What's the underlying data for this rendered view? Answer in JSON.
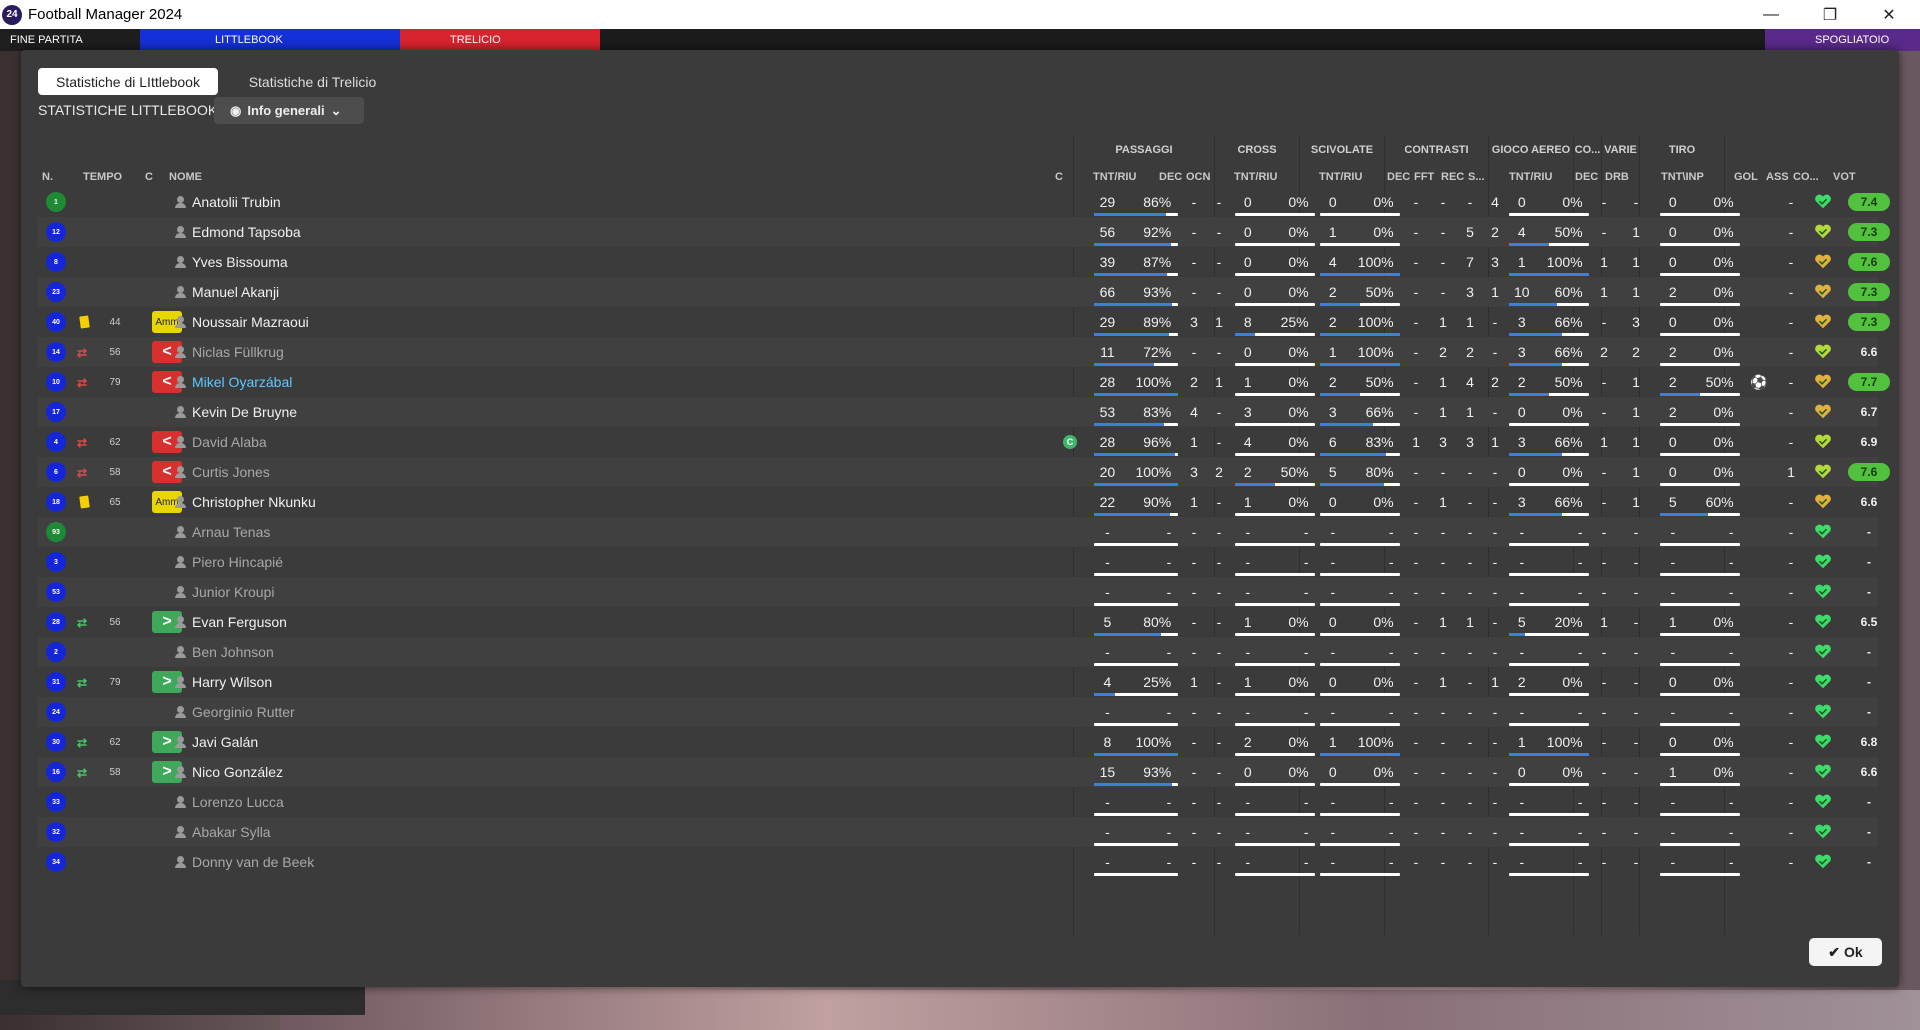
{
  "app": {
    "title": "Football Manager 2024",
    "logo_text": "24"
  },
  "window_controls": {
    "minimize": "—",
    "maximize": "❐",
    "close": "✕"
  },
  "topbar": {
    "match_end": "FINE PARTITA",
    "home": "LITTLEBOOK",
    "away": "TRELICIO",
    "right": "SPOGLIATOIO"
  },
  "tabs": [
    {
      "label": "Statistiche di LIttlebook",
      "active": true
    },
    {
      "label": "Statistiche di Trelicio",
      "active": false
    }
  ],
  "subheader": "STATISTICHE LITTLEBOOK",
  "dropdown": {
    "label": "Info generali"
  },
  "groups": {
    "passaggi": "PASSAGGI",
    "cross": "CROSS",
    "scivolate": "SCIVOLATE",
    "contrasti": "CONTRASTI",
    "gioco_aereo": "GIOCO AEREO",
    "co": "CO...",
    "varie": "VARIE",
    "tiro": "TIRO"
  },
  "columns": {
    "num": "N.",
    "tempo": "TEMPO",
    "c": "C",
    "nome": "NOME",
    "c2": "C",
    "pass_tr": "TNT/RIU",
    "pass_dec": "DEC",
    "pass_ocn": "OCN",
    "cross_tr": "TNT/RIU",
    "scivolate_tr": "TNT/RIU",
    "con_dec": "DEC",
    "con_fft": "FFT",
    "con_rec": "REC",
    "con_s": "S...",
    "aereo_tr": "TNT/RIU",
    "co_dec": "DEC",
    "varie_drb": "DRB",
    "tiro_tr": "TNT\\INP",
    "gol": "GOL",
    "ass": "ASS",
    "co2": "CO...",
    "vot": "VOT"
  },
  "players": [
    {
      "num": "1",
      "gk": true,
      "min": "",
      "badge": "",
      "card": "",
      "name": "Anatolii Trubin",
      "active": true,
      "captain": false,
      "p_t": "29",
      "p_p": "86%",
      "p_f": 0.86,
      "p_dec": "-",
      "p_ocn": "-",
      "c_t": "0",
      "c_p": "0%",
      "c_f": 0,
      "s_t": "0",
      "s_p": "0%",
      "s_f": 0,
      "k_dec": "-",
      "k_fft": "-",
      "k_rec": "-",
      "k_s": "4",
      "a_t": "0",
      "a_p": "0%",
      "a_f": 0,
      "o_dec": "-",
      "drb": "-",
      "t_t": "0",
      "t_p": "0%",
      "t_f": 0,
      "gol": "",
      "ass": "-",
      "heart": "#3ddb6a",
      "vote": "7.4",
      "hi": true
    },
    {
      "num": "12",
      "gk": false,
      "min": "",
      "badge": "",
      "card": "",
      "name": "Edmond Tapsoba",
      "active": true,
      "captain": false,
      "p_t": "56",
      "p_p": "92%",
      "p_f": 0.92,
      "p_dec": "-",
      "p_ocn": "-",
      "c_t": "0",
      "c_p": "0%",
      "c_f": 0,
      "s_t": "1",
      "s_p": "0%",
      "s_f": 0,
      "k_dec": "-",
      "k_fft": "-",
      "k_rec": "5",
      "k_s": "2",
      "a_t": "4",
      "a_p": "50%",
      "a_f": 0.5,
      "o_dec": "-",
      "drb": "1",
      "t_t": "0",
      "t_p": "0%",
      "t_f": 0,
      "gol": "",
      "ass": "-",
      "heart": "#b5d83a",
      "vote": "7.3",
      "hi": true
    },
    {
      "num": "8",
      "gk": false,
      "min": "",
      "badge": "",
      "card": "",
      "name": "Yves Bissouma",
      "active": true,
      "captain": false,
      "p_t": "39",
      "p_p": "87%",
      "p_f": 0.87,
      "p_dec": "-",
      "p_ocn": "-",
      "c_t": "0",
      "c_p": "0%",
      "c_f": 0,
      "s_t": "4",
      "s_p": "100%",
      "s_f": 1,
      "k_dec": "-",
      "k_fft": "-",
      "k_rec": "7",
      "k_s": "3",
      "a_t": "1",
      "a_p": "100%",
      "a_f": 1,
      "o_dec": "1",
      "drb": "1",
      "t_t": "0",
      "t_p": "0%",
      "t_f": 0,
      "gol": "",
      "ass": "-",
      "heart": "#e0b040",
      "vote": "7.6",
      "hi": true
    },
    {
      "num": "23",
      "gk": false,
      "min": "",
      "badge": "",
      "card": "",
      "name": "Manuel Akanji",
      "active": true,
      "captain": false,
      "p_t": "66",
      "p_p": "93%",
      "p_f": 0.93,
      "p_dec": "-",
      "p_ocn": "-",
      "c_t": "0",
      "c_p": "0%",
      "c_f": 0,
      "s_t": "2",
      "s_p": "50%",
      "s_f": 0.5,
      "k_dec": "-",
      "k_fft": "-",
      "k_rec": "3",
      "k_s": "1",
      "a_t": "10",
      "a_p": "60%",
      "a_f": 0.6,
      "o_dec": "1",
      "drb": "1",
      "t_t": "2",
      "t_p": "0%",
      "t_f": 0,
      "gol": "",
      "ass": "-",
      "heart": "#e0b040",
      "vote": "7.3",
      "hi": true
    },
    {
      "num": "40",
      "gk": false,
      "min": "44",
      "badge": "amm",
      "card": "yellow",
      "name": "Noussair Mazraoui",
      "active": true,
      "captain": false,
      "p_t": "29",
      "p_p": "89%",
      "p_f": 0.89,
      "p_dec": "3",
      "p_ocn": "1",
      "c_t": "8",
      "c_p": "25%",
      "c_f": 0.25,
      "s_t": "2",
      "s_p": "100%",
      "s_f": 1,
      "k_dec": "-",
      "k_fft": "1",
      "k_rec": "1",
      "k_s": "-",
      "a_t": "3",
      "a_p": "66%",
      "a_f": 0.66,
      "o_dec": "-",
      "drb": "3",
      "t_t": "0",
      "t_p": "0%",
      "t_f": 0,
      "gol": "",
      "ass": "-",
      "heart": "#e0b040",
      "vote": "7.3",
      "hi": true
    },
    {
      "num": "14",
      "gk": false,
      "min": "56",
      "badge": "out",
      "card": "subout",
      "name": "Niclas Füllkrug",
      "active": false,
      "captain": false,
      "p_t": "11",
      "p_p": "72%",
      "p_f": 0.72,
      "p_dec": "-",
      "p_ocn": "-",
      "c_t": "0",
      "c_p": "0%",
      "c_f": 0,
      "s_t": "1",
      "s_p": "100%",
      "s_f": 1,
      "k_dec": "-",
      "k_fft": "2",
      "k_rec": "2",
      "k_s": "-",
      "a_t": "3",
      "a_p": "66%",
      "a_f": 0.66,
      "o_dec": "2",
      "drb": "2",
      "t_t": "2",
      "t_p": "0%",
      "t_f": 0,
      "gol": "",
      "ass": "-",
      "heart": "#b5d83a",
      "vote": "6.6",
      "hi": false
    },
    {
      "num": "10",
      "gk": false,
      "min": "79",
      "badge": "out",
      "card": "subout",
      "name": "Mikel Oyarzábal",
      "active": false,
      "captain": false,
      "highlight": true,
      "p_t": "28",
      "p_p": "100%",
      "p_f": 1,
      "p_dec": "2",
      "p_ocn": "1",
      "c_t": "1",
      "c_p": "0%",
      "c_f": 0,
      "s_t": "2",
      "s_p": "50%",
      "s_f": 0.5,
      "k_dec": "-",
      "k_fft": "1",
      "k_rec": "4",
      "k_s": "2",
      "a_t": "2",
      "a_p": "50%",
      "a_f": 0.5,
      "o_dec": "-",
      "drb": "1",
      "t_t": "2",
      "t_p": "50%",
      "t_f": 0.5,
      "gol": "⚽",
      "ass": "-",
      "heart": "#e0b040",
      "vote": "7.7",
      "hi": true
    },
    {
      "num": "17",
      "gk": false,
      "min": "",
      "badge": "",
      "card": "",
      "name": "Kevin De Bruyne",
      "active": true,
      "captain": false,
      "p_t": "53",
      "p_p": "83%",
      "p_f": 0.83,
      "p_dec": "4",
      "p_ocn": "-",
      "c_t": "3",
      "c_p": "0%",
      "c_f": 0,
      "s_t": "3",
      "s_p": "66%",
      "s_f": 0.66,
      "k_dec": "-",
      "k_fft": "1",
      "k_rec": "1",
      "k_s": "-",
      "a_t": "0",
      "a_p": "0%",
      "a_f": 0,
      "o_dec": "-",
      "drb": "1",
      "t_t": "2",
      "t_p": "0%",
      "t_f": 0,
      "gol": "",
      "ass": "-",
      "heart": "#e0b040",
      "vote": "6.7",
      "hi": false
    },
    {
      "num": "4",
      "gk": false,
      "min": "62",
      "badge": "out",
      "card": "subout",
      "name": "David Alaba",
      "active": false,
      "captain": true,
      "p_t": "28",
      "p_p": "96%",
      "p_f": 0.96,
      "p_dec": "1",
      "p_ocn": "-",
      "c_t": "4",
      "c_p": "0%",
      "c_f": 0,
      "s_t": "6",
      "s_p": "83%",
      "s_f": 0.83,
      "k_dec": "1",
      "k_fft": "3",
      "k_rec": "3",
      "k_s": "1",
      "a_t": "3",
      "a_p": "66%",
      "a_f": 0.66,
      "o_dec": "1",
      "drb": "1",
      "t_t": "0",
      "t_p": "0%",
      "t_f": 0,
      "gol": "",
      "ass": "-",
      "heart": "#b5d83a",
      "vote": "6.9",
      "hi": false
    },
    {
      "num": "6",
      "gk": false,
      "min": "58",
      "badge": "out",
      "card": "subout",
      "name": "Curtis Jones",
      "active": false,
      "captain": false,
      "p_t": "20",
      "p_p": "100%",
      "p_f": 1,
      "p_dec": "3",
      "p_ocn": "2",
      "c_t": "2",
      "c_p": "50%",
      "c_f": 0.5,
      "s_t": "5",
      "s_p": "80%",
      "s_f": 0.8,
      "k_dec": "-",
      "k_fft": "-",
      "k_rec": "-",
      "k_s": "-",
      "a_t": "0",
      "a_p": "0%",
      "a_f": 0,
      "o_dec": "-",
      "drb": "1",
      "t_t": "0",
      "t_p": "0%",
      "t_f": 0,
      "gol": "",
      "ass": "1",
      "heart": "#b5d83a",
      "vote": "7.6",
      "hi": true
    },
    {
      "num": "18",
      "gk": false,
      "min": "65",
      "badge": "amm",
      "card": "yellow",
      "name": "Christopher Nkunku",
      "active": true,
      "captain": false,
      "p_t": "22",
      "p_p": "90%",
      "p_f": 0.9,
      "p_dec": "1",
      "p_ocn": "-",
      "c_t": "1",
      "c_p": "0%",
      "c_f": 0,
      "s_t": "0",
      "s_p": "0%",
      "s_f": 0,
      "k_dec": "-",
      "k_fft": "1",
      "k_rec": "-",
      "k_s": "-",
      "a_t": "3",
      "a_p": "66%",
      "a_f": 0.66,
      "o_dec": "-",
      "drb": "1",
      "t_t": "5",
      "t_p": "60%",
      "t_f": 0.6,
      "gol": "",
      "ass": "-",
      "heart": "#e0b040",
      "vote": "6.6",
      "hi": false
    },
    {
      "num": "93",
      "gk": true,
      "min": "",
      "badge": "",
      "card": "",
      "name": "Arnau Tenas",
      "active": false,
      "captain": false,
      "p_t": "-",
      "p_p": "-",
      "p_f": 0,
      "p_dec": "-",
      "p_ocn": "-",
      "c_t": "-",
      "c_p": "-",
      "c_f": 0,
      "s_t": "-",
      "s_p": "-",
      "s_f": 0,
      "k_dec": "-",
      "k_fft": "-",
      "k_rec": "-",
      "k_s": "-",
      "a_t": "-",
      "a_p": "-",
      "a_f": 0,
      "o_dec": "-",
      "drb": "-",
      "t_t": "-",
      "t_p": "-",
      "t_f": 0,
      "gol": "",
      "ass": "-",
      "heart": "#3ddb6a",
      "vote": "-",
      "hi": false
    },
    {
      "num": "3",
      "gk": false,
      "min": "",
      "badge": "",
      "card": "",
      "name": "Piero Hincapié",
      "active": false,
      "captain": false,
      "p_t": "-",
      "p_p": "-",
      "p_f": 0,
      "p_dec": "-",
      "p_ocn": "-",
      "c_t": "-",
      "c_p": "-",
      "c_f": 0,
      "s_t": "-",
      "s_p": "-",
      "s_f": 0,
      "k_dec": "-",
      "k_fft": "-",
      "k_rec": "-",
      "k_s": "-",
      "a_t": "-",
      "a_p": "-",
      "a_f": 0,
      "o_dec": "-",
      "drb": "-",
      "t_t": "-",
      "t_p": "-",
      "t_f": 0,
      "gol": "",
      "ass": "-",
      "heart": "#3ddb6a",
      "vote": "-",
      "hi": false
    },
    {
      "num": "53",
      "gk": false,
      "min": "",
      "badge": "",
      "card": "",
      "name": "Junior Kroupi",
      "active": false,
      "captain": false,
      "p_t": "-",
      "p_p": "-",
      "p_f": 0,
      "p_dec": "-",
      "p_ocn": "-",
      "c_t": "-",
      "c_p": "-",
      "c_f": 0,
      "s_t": "-",
      "s_p": "-",
      "s_f": 0,
      "k_dec": "-",
      "k_fft": "-",
      "k_rec": "-",
      "k_s": "-",
      "a_t": "-",
      "a_p": "-",
      "a_f": 0,
      "o_dec": "-",
      "drb": "-",
      "t_t": "-",
      "t_p": "-",
      "t_f": 0,
      "gol": "",
      "ass": "-",
      "heart": "#3ddb6a",
      "vote": "-",
      "hi": false
    },
    {
      "num": "28",
      "gk": false,
      "min": "56",
      "badge": "in",
      "card": "subin",
      "name": "Evan Ferguson",
      "active": true,
      "captain": false,
      "p_t": "5",
      "p_p": "80%",
      "p_f": 0.8,
      "p_dec": "-",
      "p_ocn": "-",
      "c_t": "1",
      "c_p": "0%",
      "c_f": 0,
      "s_t": "0",
      "s_p": "0%",
      "s_f": 0,
      "k_dec": "-",
      "k_fft": "1",
      "k_rec": "1",
      "k_s": "-",
      "a_t": "5",
      "a_p": "20%",
      "a_f": 0.2,
      "o_dec": "1",
      "drb": "-",
      "t_t": "1",
      "t_p": "0%",
      "t_f": 0,
      "gol": "",
      "ass": "-",
      "heart": "#3ddb6a",
      "vote": "6.5",
      "hi": false
    },
    {
      "num": "2",
      "gk": false,
      "min": "",
      "badge": "",
      "card": "",
      "name": "Ben Johnson",
      "active": false,
      "captain": false,
      "p_t": "-",
      "p_p": "-",
      "p_f": 0,
      "p_dec": "-",
      "p_ocn": "-",
      "c_t": "-",
      "c_p": "-",
      "c_f": 0,
      "s_t": "-",
      "s_p": "-",
      "s_f": 0,
      "k_dec": "-",
      "k_fft": "-",
      "k_rec": "-",
      "k_s": "-",
      "a_t": "-",
      "a_p": "-",
      "a_f": 0,
      "o_dec": "-",
      "drb": "-",
      "t_t": "-",
      "t_p": "-",
      "t_f": 0,
      "gol": "",
      "ass": "-",
      "heart": "#3ddb6a",
      "vote": "-",
      "hi": false
    },
    {
      "num": "31",
      "gk": false,
      "min": "79",
      "badge": "in",
      "card": "subin",
      "name": "Harry Wilson",
      "active": true,
      "captain": false,
      "p_t": "4",
      "p_p": "25%",
      "p_f": 0.25,
      "p_dec": "1",
      "p_ocn": "-",
      "c_t": "1",
      "c_p": "0%",
      "c_f": 0,
      "s_t": "0",
      "s_p": "0%",
      "s_f": 0,
      "k_dec": "-",
      "k_fft": "1",
      "k_rec": "-",
      "k_s": "1",
      "a_t": "2",
      "a_p": "0%",
      "a_f": 0,
      "o_dec": "-",
      "drb": "-",
      "t_t": "0",
      "t_p": "0%",
      "t_f": 0,
      "gol": "",
      "ass": "-",
      "heart": "#3ddb6a",
      "vote": "-",
      "hi": false
    },
    {
      "num": "24",
      "gk": false,
      "min": "",
      "badge": "",
      "card": "",
      "name": "Georginio Rutter",
      "active": false,
      "captain": false,
      "p_t": "-",
      "p_p": "-",
      "p_f": 0,
      "p_dec": "-",
      "p_ocn": "-",
      "c_t": "-",
      "c_p": "-",
      "c_f": 0,
      "s_t": "-",
      "s_p": "-",
      "s_f": 0,
      "k_dec": "-",
      "k_fft": "-",
      "k_rec": "-",
      "k_s": "-",
      "a_t": "-",
      "a_p": "-",
      "a_f": 0,
      "o_dec": "-",
      "drb": "-",
      "t_t": "-",
      "t_p": "-",
      "t_f": 0,
      "gol": "",
      "ass": "-",
      "heart": "#3ddb6a",
      "vote": "-",
      "hi": false
    },
    {
      "num": "30",
      "gk": false,
      "min": "62",
      "badge": "in",
      "card": "subin",
      "name": "Javi Galán",
      "active": true,
      "captain": false,
      "p_t": "8",
      "p_p": "100%",
      "p_f": 1,
      "p_dec": "-",
      "p_ocn": "-",
      "c_t": "2",
      "c_p": "0%",
      "c_f": 0,
      "s_t": "1",
      "s_p": "100%",
      "s_f": 1,
      "k_dec": "-",
      "k_fft": "-",
      "k_rec": "-",
      "k_s": "-",
      "a_t": "1",
      "a_p": "100%",
      "a_f": 1,
      "o_dec": "-",
      "drb": "-",
      "t_t": "0",
      "t_p": "0%",
      "t_f": 0,
      "gol": "",
      "ass": "-",
      "heart": "#3ddb6a",
      "vote": "6.8",
      "hi": false
    },
    {
      "num": "16",
      "gk": false,
      "min": "58",
      "badge": "in",
      "card": "subin",
      "name": "Nico González",
      "active": true,
      "captain": false,
      "p_t": "15",
      "p_p": "93%",
      "p_f": 0.93,
      "p_dec": "-",
      "p_ocn": "-",
      "c_t": "0",
      "c_p": "0%",
      "c_f": 0,
      "s_t": "0",
      "s_p": "0%",
      "s_f": 0,
      "k_dec": "-",
      "k_fft": "-",
      "k_rec": "-",
      "k_s": "-",
      "a_t": "0",
      "a_p": "0%",
      "a_f": 0,
      "o_dec": "-",
      "drb": "-",
      "t_t": "1",
      "t_p": "0%",
      "t_f": 0,
      "gol": "",
      "ass": "-",
      "heart": "#3ddb6a",
      "vote": "6.6",
      "hi": false
    },
    {
      "num": "33",
      "gk": false,
      "min": "",
      "badge": "",
      "card": "",
      "name": "Lorenzo Lucca",
      "active": false,
      "captain": false,
      "p_t": "-",
      "p_p": "-",
      "p_f": 0,
      "p_dec": "-",
      "p_ocn": "-",
      "c_t": "-",
      "c_p": "-",
      "c_f": 0,
      "s_t": "-",
      "s_p": "-",
      "s_f": 0,
      "k_dec": "-",
      "k_fft": "-",
      "k_rec": "-",
      "k_s": "-",
      "a_t": "-",
      "a_p": "-",
      "a_f": 0,
      "o_dec": "-",
      "drb": "-",
      "t_t": "-",
      "t_p": "-",
      "t_f": 0,
      "gol": "",
      "ass": "-",
      "heart": "#3ddb6a",
      "vote": "-",
      "hi": false
    },
    {
      "num": "32",
      "gk": false,
      "min": "",
      "badge": "",
      "card": "",
      "name": "Abakar Sylla",
      "active": false,
      "captain": false,
      "p_t": "-",
      "p_p": "-",
      "p_f": 0,
      "p_dec": "-",
      "p_ocn": "-",
      "c_t": "-",
      "c_p": "-",
      "c_f": 0,
      "s_t": "-",
      "s_p": "-",
      "s_f": 0,
      "k_dec": "-",
      "k_fft": "-",
      "k_rec": "-",
      "k_s": "-",
      "a_t": "-",
      "a_p": "-",
      "a_f": 0,
      "o_dec": "-",
      "drb": "-",
      "t_t": "-",
      "t_p": "-",
      "t_f": 0,
      "gol": "",
      "ass": "-",
      "heart": "#3ddb6a",
      "vote": "-",
      "hi": false
    },
    {
      "num": "34",
      "gk": false,
      "min": "",
      "badge": "",
      "card": "",
      "name": "Donny van de Beek",
      "active": false,
      "captain": false,
      "p_t": "-",
      "p_p": "-",
      "p_f": 0,
      "p_dec": "-",
      "p_ocn": "-",
      "c_t": "-",
      "c_p": "-",
      "c_f": 0,
      "s_t": "-",
      "s_p": "-",
      "s_f": 0,
      "k_dec": "-",
      "k_fft": "-",
      "k_rec": "-",
      "k_s": "-",
      "a_t": "-",
      "a_p": "-",
      "a_f": 0,
      "o_dec": "-",
      "drb": "-",
      "t_t": "-",
      "t_p": "-",
      "t_f": 0,
      "gol": "",
      "ass": "-",
      "heart": "#3ddb6a",
      "vote": "-",
      "hi": false
    }
  ],
  "badges": {
    "amm": "Amm",
    "out": "<",
    "in": ">",
    "captain": "C"
  },
  "ok_button": {
    "label": "Ok",
    "icon": "✔"
  },
  "colors": {
    "accent_blue": "#3f7fd6",
    "vote_high": "#52c23e",
    "highlight_name": "#5ec8ff"
  }
}
